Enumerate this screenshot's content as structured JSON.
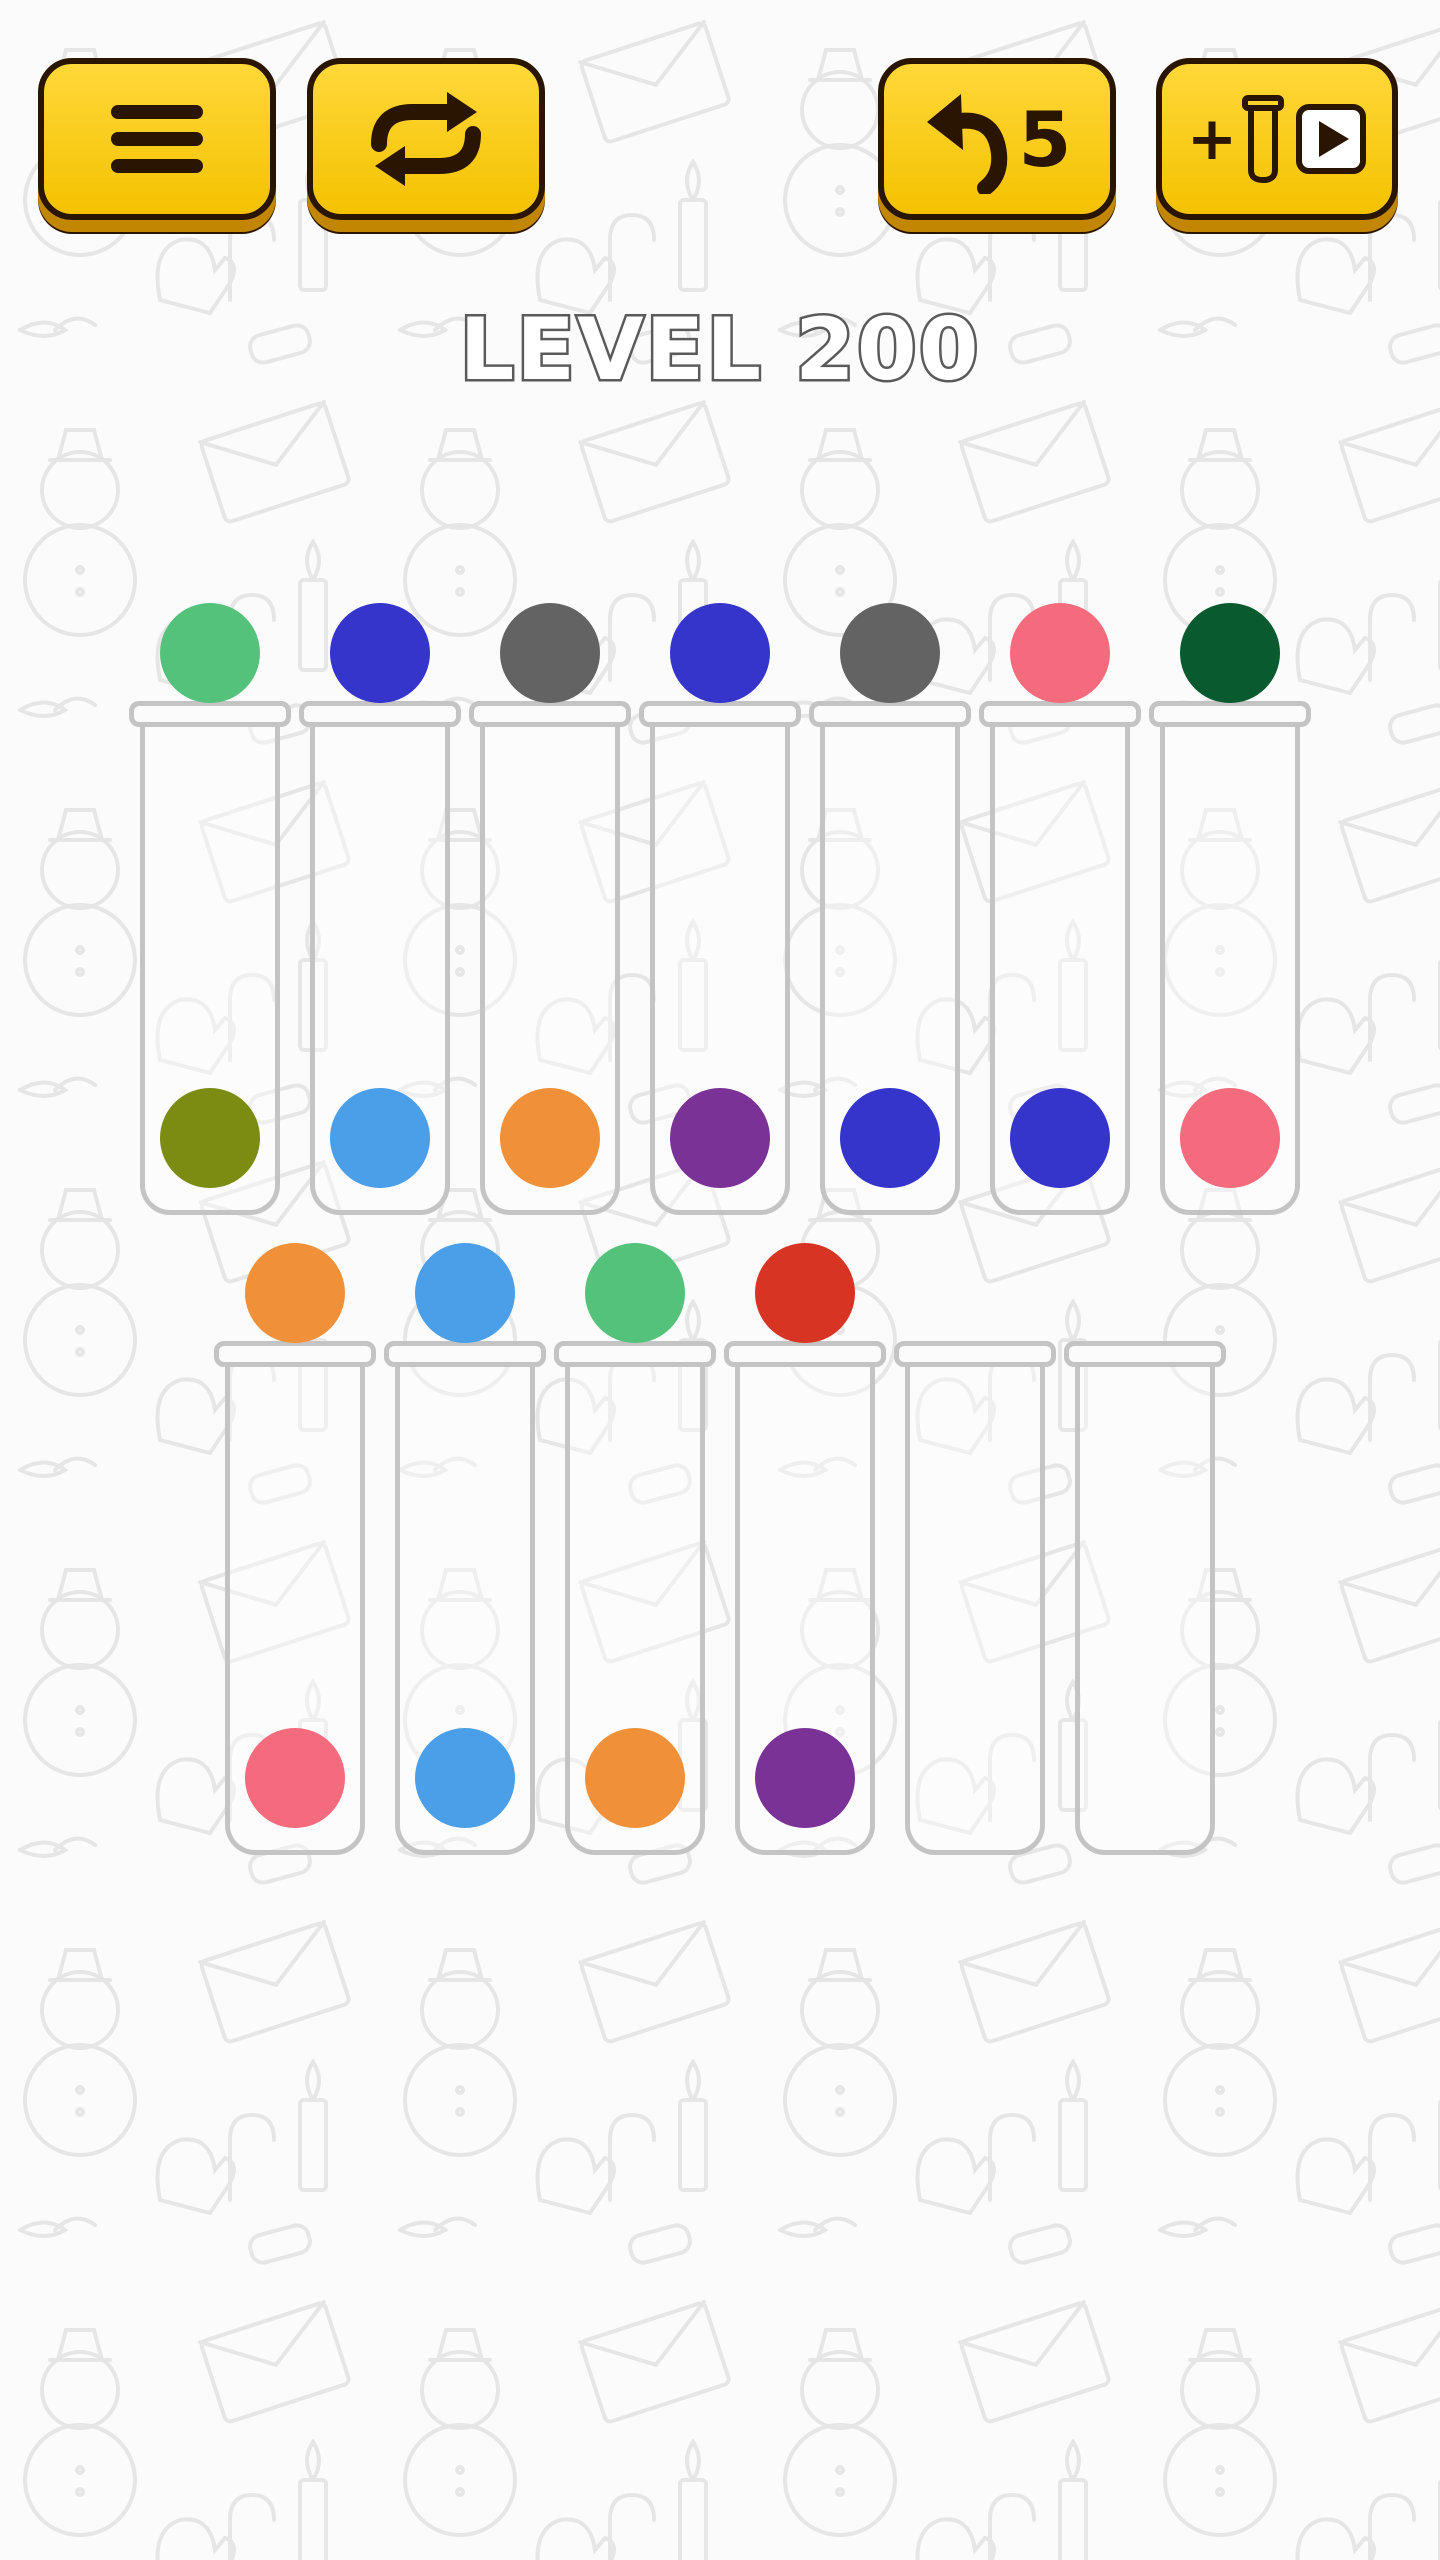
{
  "toolbar": {
    "menu_icon": "hamburger-menu-icon",
    "restart_icon": "restart-arrows-icon",
    "undo_icon": "undo-arrow-icon",
    "undo_count": "5",
    "add_tube_label": "+",
    "add_tube_icon": "tube-icon",
    "video_icon": "play-video-icon"
  },
  "level_title": "LEVEL 200",
  "colors": {
    "button_yellow": "#f9cf13",
    "tube_outline": "#c4c4c4",
    "green": "#55c27c",
    "blue": "#3535cc",
    "gray": "#636363",
    "pink": "#f36b7c",
    "dark_green": "#0a5a30",
    "olive": "#7c8b12",
    "light_blue": "#4a9fe8",
    "orange": "#f0913a",
    "purple": "#7a3296",
    "red": "#d83424"
  },
  "tubes": [
    {
      "row": 1,
      "lifted": "green",
      "contents": [
        "olive"
      ]
    },
    {
      "row": 1,
      "lifted": "blue",
      "contents": [
        "light_blue"
      ]
    },
    {
      "row": 1,
      "lifted": "gray",
      "contents": [
        "orange"
      ]
    },
    {
      "row": 1,
      "lifted": "blue",
      "contents": [
        "purple"
      ]
    },
    {
      "row": 1,
      "lifted": "gray",
      "contents": [
        "blue"
      ]
    },
    {
      "row": 1,
      "lifted": "pink",
      "contents": [
        "blue"
      ]
    },
    {
      "row": 1,
      "lifted": "dark_green",
      "contents": [
        "pink"
      ]
    },
    {
      "row": 2,
      "lifted": "orange",
      "contents": [
        "pink"
      ]
    },
    {
      "row": 2,
      "lifted": "light_blue",
      "contents": [
        "light_blue"
      ]
    },
    {
      "row": 2,
      "lifted": "green",
      "contents": [
        "orange"
      ]
    },
    {
      "row": 2,
      "lifted": "red",
      "contents": [
        "purple"
      ]
    },
    {
      "row": 2,
      "lifted": null,
      "contents": []
    },
    {
      "row": 2,
      "lifted": null,
      "contents": []
    }
  ]
}
